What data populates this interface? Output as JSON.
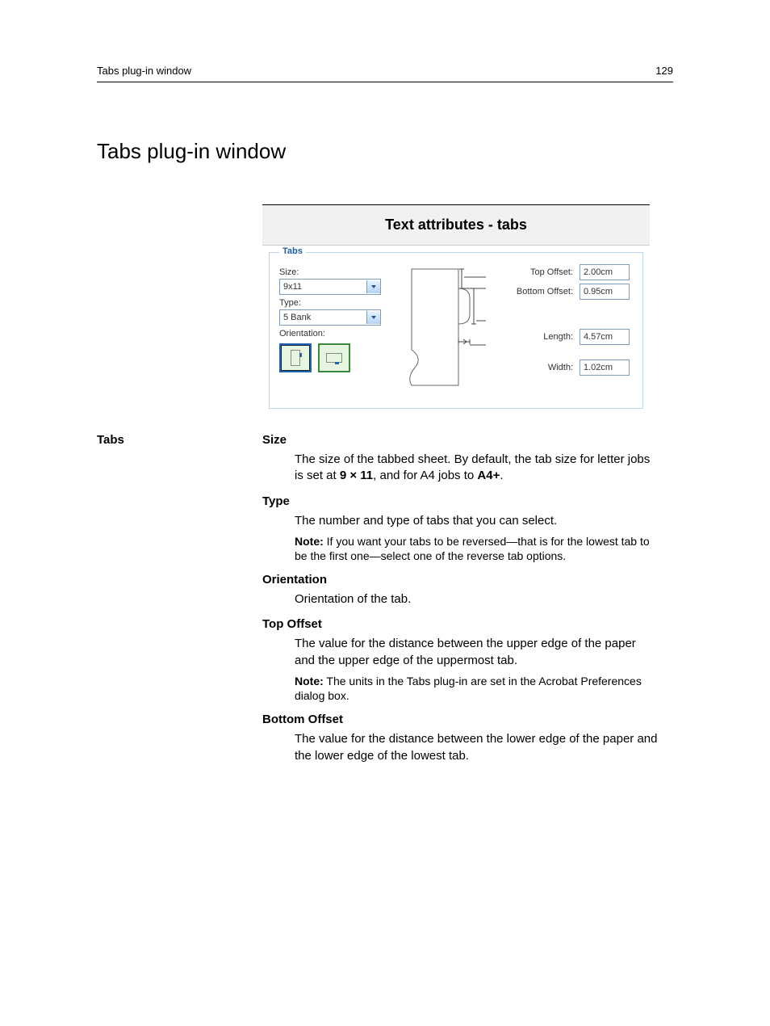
{
  "header": {
    "left": "Tabs plug-in window",
    "right": "129"
  },
  "title": "Tabs plug-in window",
  "figure": {
    "caption": "Text attributes - tabs",
    "group_legend": "Tabs",
    "labels": {
      "size": "Size:",
      "type": "Type:",
      "orientation": "Orientation:",
      "top_offset": "Top Offset:",
      "bottom_offset": "Bottom Offset:",
      "length": "Length:",
      "width": "Width:"
    },
    "values": {
      "size": "9x11",
      "type": "5 Bank",
      "top_offset": "2.00cm",
      "bottom_offset": "0.95cm",
      "length": "4.57cm",
      "width": "1.02cm"
    }
  },
  "definitions": {
    "section_label": "Tabs",
    "items": [
      {
        "title": "Size",
        "body": "The size of the tabbed sheet. By default, the tab size for letter jobs is set at 9 × 11, and for A4 jobs to A4+.",
        "body_html_segments": [
          "The size of the tabbed sheet. By default, the tab size for letter jobs is set at ",
          "9 × 11",
          ", and for A4 jobs to ",
          "A4+",
          "."
        ]
      },
      {
        "title": "Type",
        "body": "The number and type of tabs that you can select.",
        "note": "Note: If you want your tabs to be reversed—that is for the lowest tab to be the first one—select one of the reverse tab options."
      },
      {
        "title": "Orientation",
        "body": "Orientation of the tab."
      },
      {
        "title": "Top Offset",
        "body": "The value for the distance between the upper edge of the paper and the upper edge of the uppermost tab.",
        "note": "Note: The units in the Tabs plug-in are set in the Acrobat Preferences dialog box."
      },
      {
        "title": "Bottom Offset",
        "body": "The value for the distance between the lower edge of the paper and the lower edge of the lowest tab."
      }
    ]
  }
}
